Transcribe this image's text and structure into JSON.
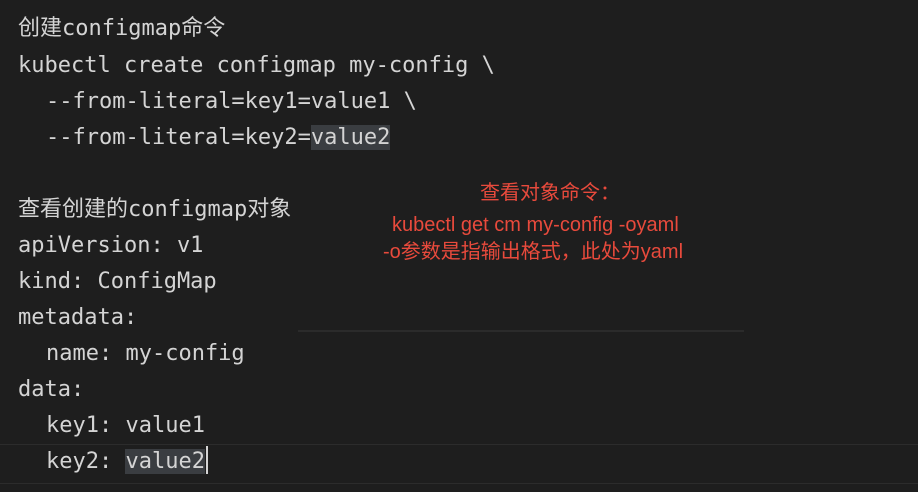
{
  "editor": {
    "lines": {
      "cmd_comment": "创建configmap命令",
      "cmd1": "kubectl create configmap my-config \\",
      "cmd2": "--from-literal=key1=value1 \\",
      "cmd3_prefix": "--from-literal=key2=",
      "cmd3_value": "value2",
      "view_comment": "查看创建的configmap对象",
      "api_version": "apiVersion: v1",
      "kind": "kind: ConfigMap",
      "metadata": "metadata:",
      "name": "name: my-config",
      "data": "data:",
      "key1": "key1: value1",
      "key2_prefix": "key2: ",
      "key2_value": "value2"
    }
  },
  "annotation": {
    "title": "查看对象命令：",
    "command": "kubectl get cm my-config -oyaml",
    "explanation": "-o参数是指输出格式，此处为yaml"
  },
  "colors": {
    "background": "#1e1e1e",
    "text": "#d4d4d4",
    "annotation": "#e84a3c",
    "selection": "#3a3d41"
  }
}
